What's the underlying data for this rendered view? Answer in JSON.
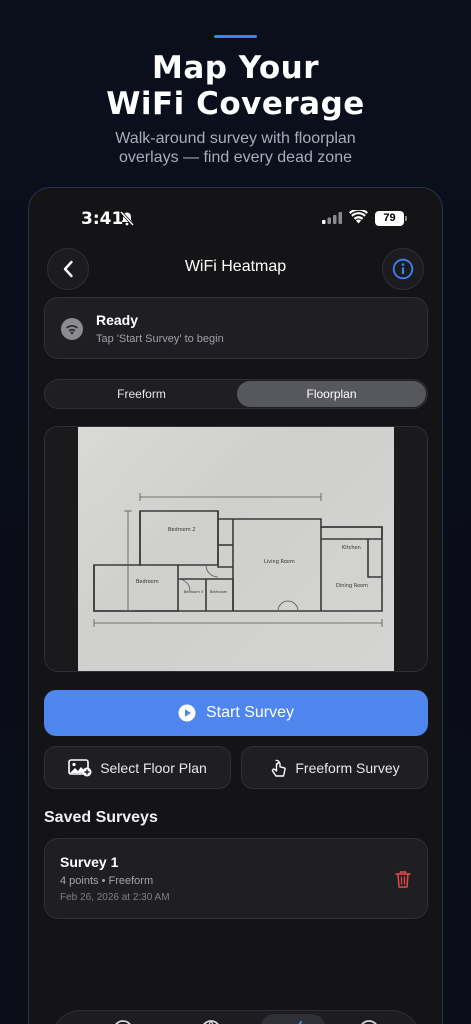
{
  "promo": {
    "headline_line1": "Map Your",
    "headline_line2": "WiFi Coverage",
    "subhead_line1": "Walk-around survey with floorplan",
    "subhead_line2": "overlays — find every dead zone"
  },
  "status_bar": {
    "time": "3:41",
    "battery": "79"
  },
  "nav": {
    "title": "WiFi Heatmap"
  },
  "status_card": {
    "title": "Ready",
    "subtitle": "Tap 'Start Survey' to begin"
  },
  "mode_tabs": [
    {
      "label": "Freeform",
      "selected": false
    },
    {
      "label": "Floorplan",
      "selected": true
    }
  ],
  "floorplan": {
    "rooms": [
      "Bedroom 2",
      "Living Room",
      "Kitchen",
      "Bedroom",
      "Bedroom 3",
      "Bathroom",
      "Dining Room"
    ]
  },
  "actions": {
    "start_survey": "Start Survey",
    "select_floor_plan": "Select Floor Plan",
    "freeform_survey": "Freeform Survey"
  },
  "saved": {
    "section_title": "Saved Surveys",
    "items": [
      {
        "name": "Survey 1",
        "meta": "4 points • Freeform",
        "date": "Feb 26, 2026 at 2:30 AM"
      }
    ]
  },
  "colors": {
    "accent": "#4f86ee",
    "info_icon": "#3b82f6",
    "delete": "#e5484d",
    "card_bg": "#1f1f23"
  }
}
